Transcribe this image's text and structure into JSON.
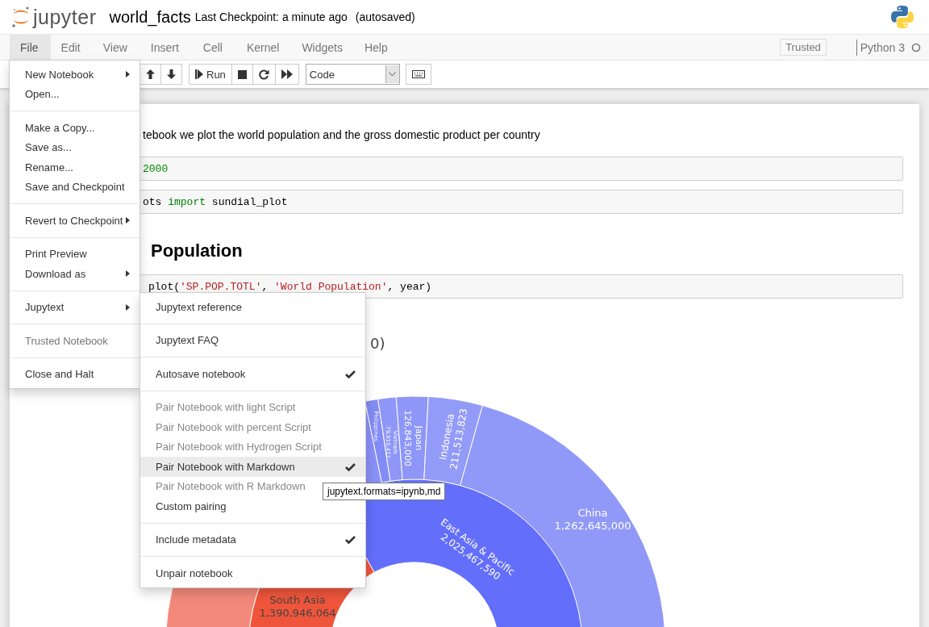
{
  "header": {
    "logo_text": "jupyter",
    "notebook_name": "world_facts",
    "checkpoint": "Last Checkpoint: a minute ago",
    "autosave": "(autosaved)"
  },
  "menubar": {
    "items": [
      {
        "label": "File",
        "selected": true
      },
      {
        "label": "Edit",
        "selected": false
      },
      {
        "label": "View",
        "selected": false
      },
      {
        "label": "Insert",
        "selected": false
      },
      {
        "label": "Cell",
        "selected": false
      },
      {
        "label": "Kernel",
        "selected": false
      },
      {
        "label": "Widgets",
        "selected": false
      },
      {
        "label": "Help",
        "selected": false
      }
    ],
    "trusted": "Trusted",
    "kernel": "Python 3"
  },
  "toolbar": {
    "run_label": "Run",
    "cell_type": "Code"
  },
  "notebook": {
    "markdown": "tebook we plot the world population and the gross domestic product per country",
    "cell_1": [
      {
        "text": "2000",
        "kind": "number"
      }
    ],
    "cell_2": [
      {
        "text": "ots ",
        "kind": "plain"
      },
      {
        "text": "import",
        "kind": "keyword"
      },
      {
        "text": " sundial_plot",
        "kind": "plain"
      }
    ],
    "heading": "Population",
    "cell_3": [
      {
        "text": "plot(",
        "kind": "plain"
      },
      {
        "text": "'SP.POP.TOTL'",
        "kind": "string"
      },
      {
        "text": ", ",
        "kind": "plain"
      },
      {
        "text": "'World Population'",
        "kind": "string"
      },
      {
        "text": ", year)",
        "kind": "plain"
      }
    ],
    "chart_title": "0)",
    "sunburst_labels": [
      {
        "lines": [
          "China",
          "1,262,645,000"
        ],
        "kind": "outer"
      },
      {
        "lines": [
          "East Asia & Pacific",
          "2,025,467,590"
        ],
        "kind": "inner"
      },
      {
        "lines": [
          "Indonesia",
          "211,513,823"
        ],
        "kind": "outer"
      },
      {
        "lines": [
          "Japan",
          "126,843,000"
        ],
        "kind": "outer"
      },
      {
        "lines": [
          "Vietnam",
          "79,910,412"
        ],
        "kind": "tiny"
      },
      {
        "lines": [
          "Philippines"
        ],
        "kind": "tiny"
      },
      {
        "lines": [
          "South Asia",
          "1,390,946,064"
        ],
        "kind": "dark"
      }
    ]
  },
  "file_menu": {
    "groups": [
      [
        {
          "label": "New Notebook",
          "submenu": true,
          "disabled": false
        },
        {
          "label": "Open...",
          "submenu": false,
          "disabled": false
        }
      ],
      [
        {
          "label": "Make a Copy...",
          "submenu": false,
          "disabled": false
        },
        {
          "label": "Save as...",
          "submenu": false,
          "disabled": false
        },
        {
          "label": "Rename...",
          "submenu": false,
          "disabled": false
        },
        {
          "label": "Save and Checkpoint",
          "submenu": false,
          "disabled": false
        }
      ],
      [
        {
          "label": "Revert to Checkpoint",
          "submenu": true,
          "disabled": false
        }
      ],
      [
        {
          "label": "Print Preview",
          "submenu": false,
          "disabled": false
        },
        {
          "label": "Download as",
          "submenu": true,
          "disabled": false
        }
      ],
      [
        {
          "label": "Jupytext",
          "submenu": true,
          "disabled": false
        }
      ],
      [
        {
          "label": "Trusted Notebook",
          "submenu": false,
          "disabled": true
        }
      ],
      [
        {
          "label": "Close and Halt",
          "submenu": false,
          "disabled": false
        }
      ]
    ]
  },
  "jupytext_menu": {
    "groups": [
      [
        {
          "label": "Jupytext reference",
          "checked": false,
          "disabled": false,
          "selected": false
        }
      ],
      [
        {
          "label": "Jupytext FAQ",
          "checked": false,
          "disabled": false,
          "selected": false
        }
      ],
      [
        {
          "label": "Autosave notebook",
          "checked": true,
          "disabled": false,
          "selected": false
        }
      ],
      [
        {
          "label": "Pair Notebook with light Script",
          "checked": false,
          "disabled": true,
          "selected": false
        },
        {
          "label": "Pair Notebook with percent Script",
          "checked": false,
          "disabled": true,
          "selected": false
        },
        {
          "label": "Pair Notebook with Hydrogen Script",
          "checked": false,
          "disabled": true,
          "selected": false
        },
        {
          "label": "Pair Notebook with Markdown",
          "checked": true,
          "disabled": false,
          "selected": true
        },
        {
          "label": "Pair Notebook with R Markdown",
          "checked": false,
          "disabled": true,
          "selected": false
        },
        {
          "label": "Custom pairing",
          "checked": false,
          "disabled": false,
          "selected": false
        }
      ],
      [
        {
          "label": "Include metadata",
          "checked": true,
          "disabled": false,
          "selected": false
        }
      ],
      [
        {
          "label": "Unpair notebook",
          "checked": false,
          "disabled": false,
          "selected": false
        }
      ]
    ]
  },
  "tooltip": "jupytext.formats=ipynb,md"
}
